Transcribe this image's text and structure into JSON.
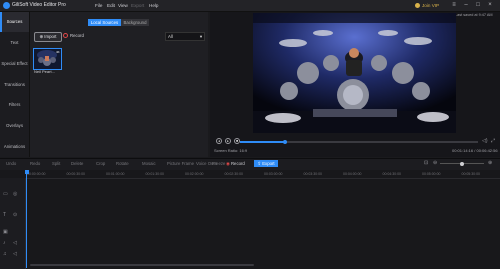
{
  "app": {
    "title": "GiliSoft Video Editor Pro",
    "vip_label": "Join VIP",
    "last_saved": "Last saved at 9:47 AM"
  },
  "menu": [
    "File",
    "Edit",
    "View",
    "Export",
    "Help"
  ],
  "sidebar": [
    {
      "label": "Sources",
      "active": true
    },
    {
      "label": "Text"
    },
    {
      "label": "Special Effect"
    },
    {
      "label": "Transitions"
    },
    {
      "label": "Filters"
    },
    {
      "label": "Overlays"
    },
    {
      "label": "Animations"
    }
  ],
  "media": {
    "tabs": [
      "Local Sources",
      "Background"
    ],
    "import_label": "Import",
    "record_label": "Record",
    "filter_value": "All",
    "clip_name": "Neil Peart...",
    "clip_badge": "4K"
  },
  "player": {
    "ratio": "Screen Ratio: 16:9",
    "timecode": "00:01:14:16 / 00:06:42:56",
    "progress_fraction": 0.19
  },
  "toolbar": {
    "items": [
      "Undo",
      "Redo",
      "Split",
      "Delete",
      "Crop",
      "Rotate",
      "Mosaic",
      "Picture Frame",
      "Voice Over",
      "Freeze"
    ],
    "record_label": "Record",
    "export_label": "Export"
  },
  "timeline": {
    "ticks": [
      "00:00:00:00",
      "00:00:30:00",
      "00:01:00:00",
      "00:01:30:00",
      "00:02:00:00",
      "00:02:30:00",
      "00:03:00:00",
      "00:03:30:00",
      "00:04:00:00",
      "00:04:30:00",
      "00:05:00:00",
      "00:05:30:00"
    ]
  },
  "colors": {
    "accent": "#2f8cf7",
    "vip": "#d9b24a"
  }
}
